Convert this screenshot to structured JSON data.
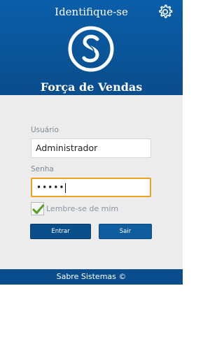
{
  "header": {
    "title": "Identifique-se",
    "app_name": "Força de Vendas",
    "settings_icon": "gear-icon",
    "logo_icon": "sabre-s-logo"
  },
  "form": {
    "username_label": "Usuário",
    "username_value": "Administrador",
    "password_label": "Senha",
    "password_value": "•••••",
    "remember_label": "Lembre-se de mim",
    "remember_checked": true,
    "enter_label": "Entrar",
    "exit_label": "Sair"
  },
  "footer": {
    "text": "Sabre Sistemas ©"
  },
  "colors": {
    "header_blue": "#0a5ea9",
    "footer_blue": "#0a4d8c",
    "focus_orange": "#f0a020",
    "check_green": "#5aa02c",
    "form_bg": "#ececec"
  }
}
